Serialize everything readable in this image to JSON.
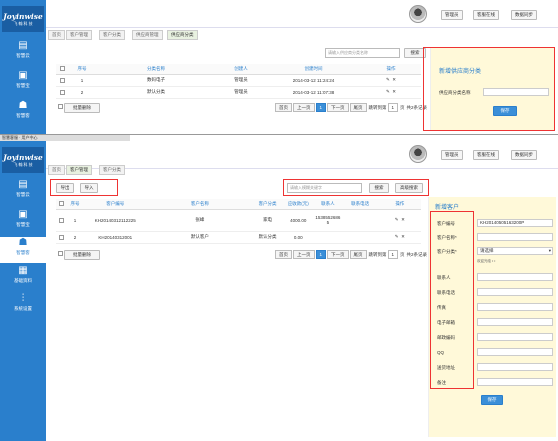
{
  "app": {
    "brand": "Joyinwise",
    "brand_sub": "飞 翰 科 技",
    "window_title": "智慧客服 · 用户中心"
  },
  "sidebar": [
    {
      "icon": "▤",
      "label": "智慧云"
    },
    {
      "icon": "▣",
      "label": "智慧宝"
    },
    {
      "icon": "☗",
      "label": "智慧客"
    },
    {
      "icon": "▦",
      "label": "基础资料"
    },
    {
      "icon": "⫶",
      "label": "系统设置"
    }
  ],
  "topbar": {
    "admin": "管理员",
    "online": "客服在线",
    "sync": "数据同步"
  },
  "panel1": {
    "tabs": [
      "首页",
      "客户管理",
      "客户分类",
      "供应商管理",
      "供应商分类"
    ],
    "search_placeholder": "请输入供应商分类名称",
    "search_label": "搜索",
    "table": {
      "headers": [
        "序号",
        "分类名称",
        "创建人",
        "创建时间",
        "操作"
      ],
      "rows": [
        {
          "no": "1",
          "name": "数码电子",
          "creator": "管理员",
          "time": "2014-03-12 11:24:24"
        },
        {
          "no": "2",
          "name": "默认分类",
          "creator": "管理员",
          "time": "2014-03-12 11:07:38"
        }
      ]
    },
    "batch_delete": "批量删除",
    "pager": {
      "first": "首页",
      "prev": "上一页",
      "current": "1",
      "next": "下一页",
      "last": "尾页",
      "jump": "跳转到第",
      "page_val": "1",
      "go": "页",
      "total": "共2条记录"
    },
    "form": {
      "title": "新增供应商分类",
      "label": "供应商分类名称",
      "save": "保存"
    }
  },
  "panel2": {
    "tabs": [
      "首页",
      "客户管理",
      "客户分类"
    ],
    "export": "导出",
    "import": "导入",
    "search_placeholder": "请输入模糊关键字",
    "search_label": "搜索",
    "advanced": "高级搜索",
    "table": {
      "headers": [
        "序号",
        "客户编号",
        "客户名称",
        "客户分类",
        "应收款(元)",
        "联系人",
        "联系电话",
        "操作"
      ],
      "rows": [
        {
          "no": "1",
          "code": "KH20140312112225",
          "name": "张峰",
          "category": "家电",
          "amount": "4000.00",
          "contact": "15385526865",
          "phone": ""
        },
        {
          "no": "2",
          "code": "KH20140312001",
          "name": "默认客户",
          "category": "默认分类",
          "amount": "0.00",
          "contact": "",
          "phone": ""
        }
      ]
    },
    "batch_delete": "批量删除",
    "pager": {
      "first": "首页",
      "prev": "上一页",
      "current": "1",
      "next": "下一页",
      "last": "尾页",
      "jump": "跳转到第",
      "page_val": "1",
      "go": "页",
      "total": "共2条记录"
    },
    "form": {
      "title": "新增客户",
      "fields": [
        {
          "label": "客户编号",
          "value": "KH20140505163200P"
        },
        {
          "label": "客户名称*",
          "value": ""
        },
        {
          "label": "客户分类*",
          "value": "请选择"
        },
        {
          "label": "",
          "value": ""
        },
        {
          "label": "联系人",
          "value": ""
        },
        {
          "label": "联系电话",
          "value": ""
        },
        {
          "label": "传真",
          "value": ""
        },
        {
          "label": "电子邮箱",
          "value": ""
        },
        {
          "label": "邮政编码",
          "value": ""
        },
        {
          "label": "QQ",
          "value": ""
        },
        {
          "label": "送货地址",
          "value": ""
        },
        {
          "label": "备注",
          "value": ""
        }
      ],
      "extra_note": "欢迎光临 • •",
      "save": "保存"
    }
  },
  "colors": {
    "brand_blue": "#2a7fcc",
    "highlight_red": "#e33",
    "form_bg": "#fff9d9"
  }
}
